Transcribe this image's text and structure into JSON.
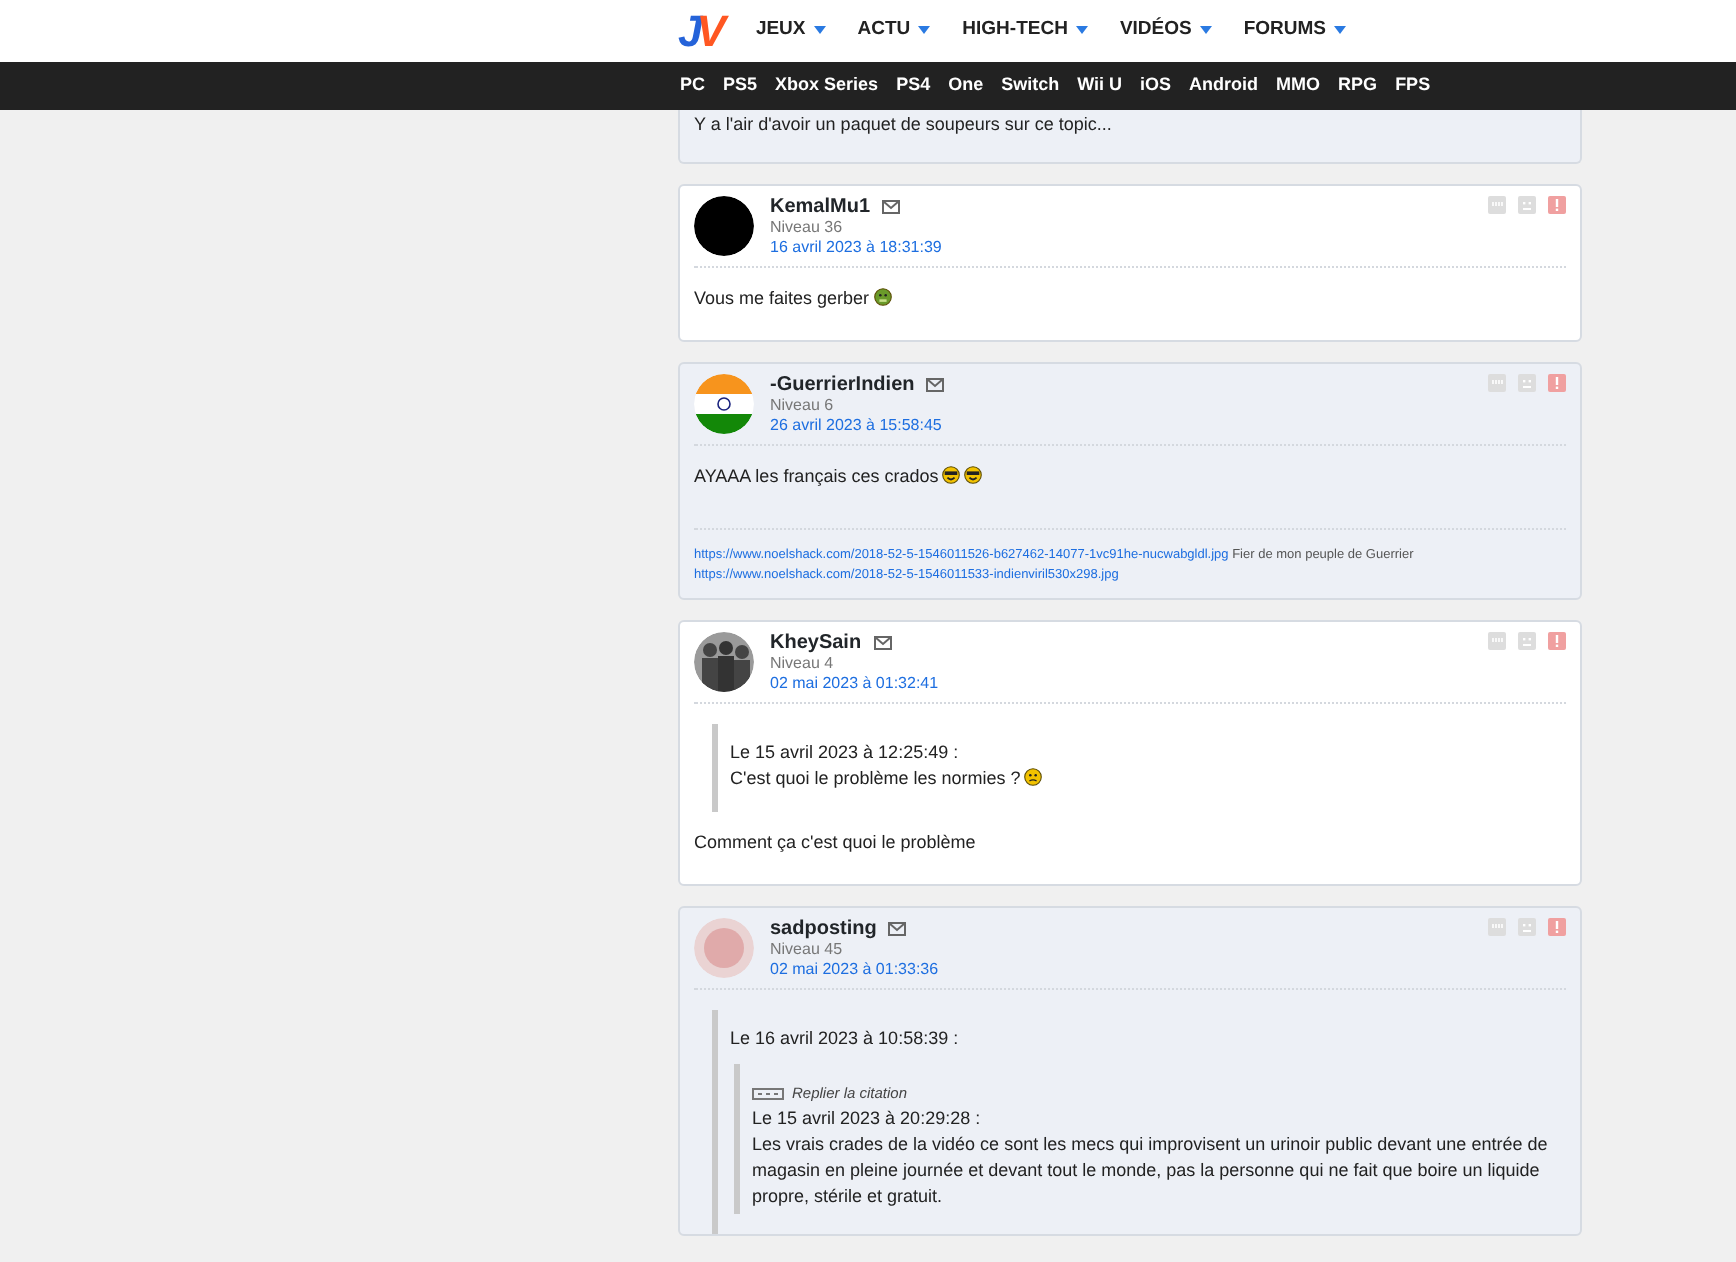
{
  "header": {
    "logo": "JV",
    "menus": [
      {
        "label": "JEUX"
      },
      {
        "label": "ACTU"
      },
      {
        "label": "HIGH-TECH"
      },
      {
        "label": "VIDÉOS"
      },
      {
        "label": "FORUMS"
      }
    ],
    "platforms": [
      "PC",
      "PS5",
      "Xbox Series",
      "PS4",
      "One",
      "Switch",
      "Wii U",
      "iOS",
      "Android",
      "MMO",
      "RPG",
      "FPS"
    ]
  },
  "posts": [
    {
      "partial": true,
      "tinted": true,
      "blocks": [
        {
          "kind": "text",
          "text": "Y a l'air d'avoir un paquet de soupeurs sur ce topic..."
        }
      ]
    },
    {
      "partial": false,
      "tinted": false,
      "author": "KemalMu1",
      "level": "Niveau 36",
      "date": "16 avril 2023 à 18:31:39",
      "avatar": {
        "kind": "dark"
      },
      "blocks": [
        {
          "kind": "text",
          "text": "Vous me faites gerber",
          "smileys": [
            {
              "kind": "sick"
            }
          ]
        }
      ]
    },
    {
      "partial": false,
      "tinted": true,
      "author": "-GuerrierIndien",
      "level": "Niveau 6",
      "date": "26 avril 2023 à 15:58:45",
      "avatar": {
        "kind": "flag"
      },
      "blocks": [
        {
          "kind": "text",
          "text": "AYAAA les français ces crados",
          "smileys": [
            {
              "kind": "laughing"
            },
            {
              "kind": "laughing"
            }
          ]
        },
        {
          "kind": "signature",
          "lines": [
            {
              "link": "https://www.noelshack.com/2018-52-5-1546011526-b627462-14077-1vc91he-nucwabgldl.jpg",
              "text": "Fier de mon peuple de Guerrier"
            },
            {
              "link": "https://www.noelshack.com/2018-52-5-1546011533-indienviril530x298.jpg"
            }
          ]
        }
      ]
    },
    {
      "partial": false,
      "tinted": false,
      "author": "KheySain",
      "level": "Niveau 4",
      "date": "02 mai 2023 à 01:32:41",
      "avatar": {
        "kind": "group"
      },
      "blocks": [
        {
          "kind": "quote",
          "header": "Le 15 avril 2023 à 12:25:49 :",
          "text": "C'est quoi le problème les normies ?",
          "smileys": [
            {
              "kind": "confused"
            }
          ]
        },
        {
          "kind": "text",
          "text": "Comment ça c'est quoi le problème"
        }
      ]
    },
    {
      "partial": false,
      "tinted": true,
      "author": "sadposting",
      "level": "Niveau 45",
      "date": "02 mai 2023 à 01:33:36",
      "avatar": {
        "kind": "pink"
      },
      "blocks": [
        {
          "kind": "quote",
          "header": "Le 16 avril 2023 à 10:58:39 :",
          "children": [
            {
              "kind": "quote",
              "toggle": "Replier la citation",
              "header": "Le 15 avril 2023 à 20:29:28 :",
              "text": "Les vrais crades de la vidéo ce sont les mecs qui improvisent un urinoir public devant une entrée de magasin en pleine journée et devant tout le monde, pas la personne qui ne fait que boire un liquide propre, stérile et gratuit."
            }
          ]
        }
      ]
    }
  ]
}
